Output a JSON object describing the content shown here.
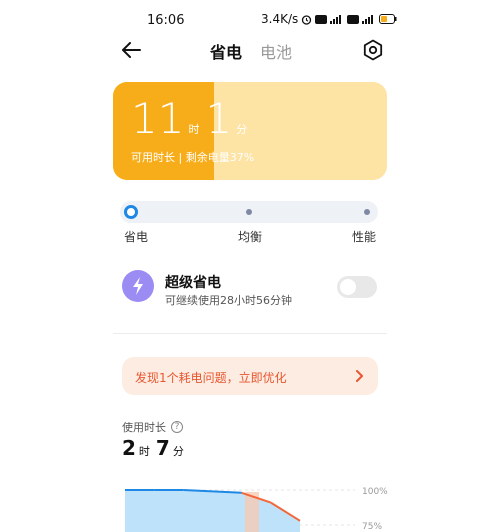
{
  "status_bar": {
    "time": "16:06",
    "speed": "3.4K/s",
    "battery_level": "39"
  },
  "header": {
    "tab_power_saving": "省电",
    "tab_battery": "电池",
    "back_icon": "arrow-left-icon",
    "settings_icon": "gear-icon"
  },
  "battery_card": {
    "hours": "11",
    "hours_unit": "时",
    "minutes": "1",
    "minutes_unit": "分",
    "subtitle": "可用时长 | 剩余电量37%",
    "battery_percent": 37
  },
  "mode_selector": {
    "modes": [
      "省电",
      "均衡",
      "性能"
    ],
    "selected_index": 0
  },
  "ultra_saver": {
    "title": "超级省电",
    "subtitle": "可继续使用28小时56分钟",
    "enabled": false,
    "icon": "lightning-icon"
  },
  "issue_banner": {
    "text": "发现1个耗电问题，立即优化"
  },
  "usage": {
    "label": "使用时长",
    "hours": "2",
    "hours_unit": "时",
    "minutes": "7",
    "minutes_unit": "分"
  },
  "chart_data": {
    "type": "area",
    "y_tick_labels": [
      "100%",
      "75%"
    ],
    "ylim": [
      0,
      100
    ],
    "series": [
      {
        "values": [
          100,
          100,
          100,
          99,
          98,
          91,
          78
        ]
      }
    ],
    "colors": {
      "line": "#1e88e5",
      "fill": "#bfe2fb",
      "charging": "#f4673a"
    }
  }
}
